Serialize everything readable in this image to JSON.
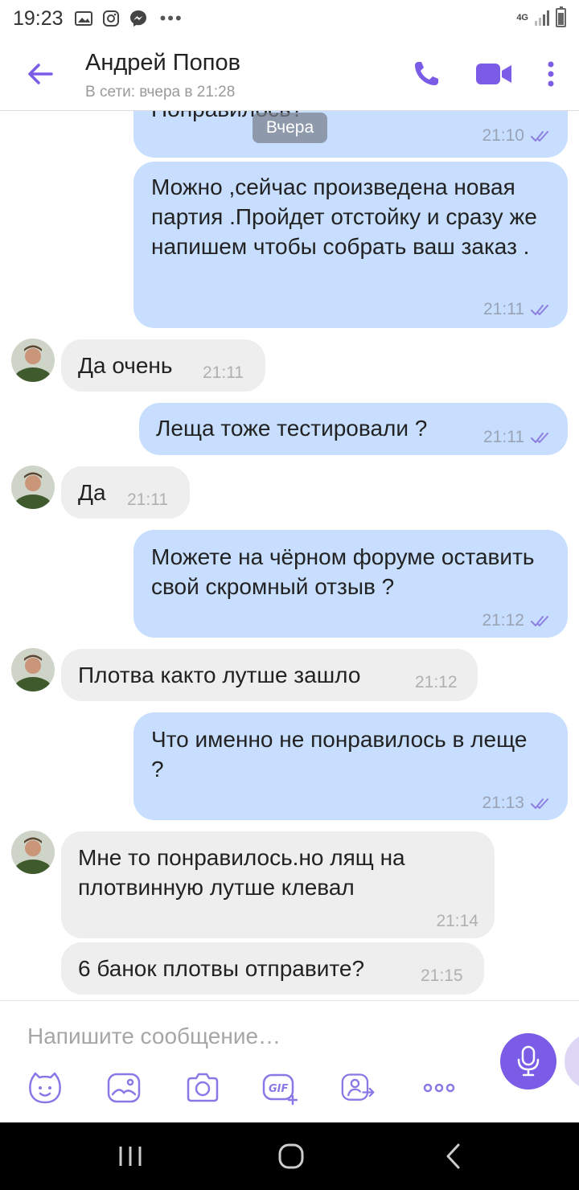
{
  "status_bar": {
    "time": "19:23",
    "network": "4G",
    "icons": [
      "gallery-icon",
      "instagram-icon",
      "messenger-icon",
      "more-dots-icon",
      "signal-icon",
      "battery-icon"
    ]
  },
  "header": {
    "contact_name": "Андрей Попов",
    "status": "В сети: вчера в 21:28",
    "accent": "#7a5ce6"
  },
  "date_chip": "Вчера",
  "messages": [
    {
      "dir": "out",
      "text": "Понравилось?",
      "time": "21:10",
      "partial": true
    },
    {
      "dir": "out",
      "text": "Можно ,сейчас произведена новая партия .Пройдет отстойку и сразу же  напишем чтобы собрать ваш заказ .",
      "time": "21:11"
    },
    {
      "dir": "in",
      "text": "Да очень",
      "time": "21:11"
    },
    {
      "dir": "out",
      "text": "Леща тоже тестировали ?",
      "time": "21:11"
    },
    {
      "dir": "in",
      "text": "Да",
      "time": "21:11"
    },
    {
      "dir": "out",
      "text": "Можете на чёрном форуме оставить свой скромный отзыв ?",
      "time": "21:12"
    },
    {
      "dir": "in",
      "text": "Плотва както лутше зашло",
      "time": "21:12"
    },
    {
      "dir": "out",
      "text": "Что именно не понравилось в леще ?",
      "time": "21:13"
    },
    {
      "dir": "in",
      "text": "Мне то понравилось.но лящ на плотвинную лутше клевал",
      "time": "21:14"
    },
    {
      "dir": "in",
      "text": "6 банок плотвы отправите?",
      "time": "21:15"
    }
  ],
  "composer": {
    "placeholder": "Напишите сообщение…",
    "tools": [
      "sticker-icon",
      "gallery-icon",
      "camera-icon",
      "gif-icon",
      "share-contact-icon",
      "more-icon"
    ]
  },
  "colors": {
    "outgoing_bubble": "#c7deff",
    "incoming_bubble": "#eeeeee",
    "accent": "#7a5ce6"
  }
}
